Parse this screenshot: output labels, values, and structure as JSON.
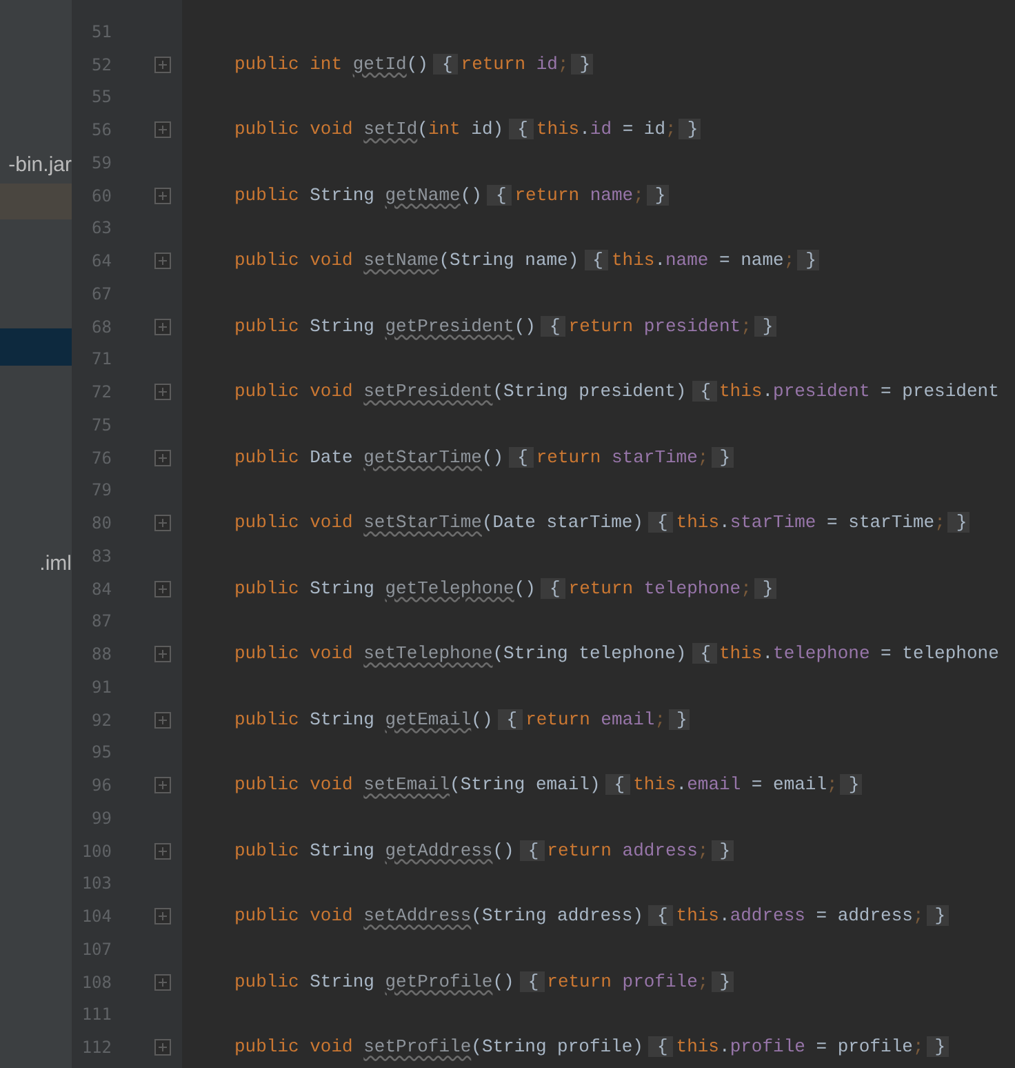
{
  "sidebar": {
    "rows": [
      {
        "label": "-bin.jar",
        "selected": false
      },
      {
        "selected": true,
        "focused": false
      },
      {
        "selected": true,
        "focused": true
      },
      {
        "label": ".iml",
        "selected": false
      }
    ]
  },
  "editor": {
    "lines": [
      {
        "number": "51"
      },
      {
        "number": "52",
        "collapsed": true,
        "tokens": [
          {
            "kind": "kw",
            "text": "public int "
          },
          {
            "kind": "method",
            "text": "getId"
          },
          {
            "kind": "plain",
            "text": "()"
          },
          {
            "kind": "open",
            "text": "{"
          },
          {
            "kind": "kw",
            "text": "return "
          },
          {
            "kind": "field",
            "text": "id"
          },
          {
            "kind": "semi",
            "text": ";"
          },
          {
            "kind": "close",
            "text": "}"
          }
        ]
      },
      {
        "number": "55"
      },
      {
        "number": "56",
        "collapsed": true,
        "tokens": [
          {
            "kind": "kw",
            "text": "public void "
          },
          {
            "kind": "method",
            "text": "setId"
          },
          {
            "kind": "plain",
            "text": "("
          },
          {
            "kind": "kw",
            "text": "int "
          },
          {
            "kind": "plain",
            "text": "id)"
          },
          {
            "kind": "open",
            "text": "{"
          },
          {
            "kind": "kw",
            "text": "this"
          },
          {
            "kind": "plain",
            "text": "."
          },
          {
            "kind": "field",
            "text": "id"
          },
          {
            "kind": "plain",
            "text": " = id"
          },
          {
            "kind": "semi",
            "text": ";"
          },
          {
            "kind": "close",
            "text": "}"
          }
        ]
      },
      {
        "number": "59"
      },
      {
        "number": "60",
        "collapsed": true,
        "tokens": [
          {
            "kind": "kw",
            "text": "public "
          },
          {
            "kind": "plain",
            "text": "String "
          },
          {
            "kind": "method",
            "text": "getName"
          },
          {
            "kind": "plain",
            "text": "()"
          },
          {
            "kind": "open",
            "text": "{"
          },
          {
            "kind": "kw",
            "text": "return "
          },
          {
            "kind": "field",
            "text": "name"
          },
          {
            "kind": "semi",
            "text": ";"
          },
          {
            "kind": "close",
            "text": "}"
          }
        ]
      },
      {
        "number": "63"
      },
      {
        "number": "64",
        "collapsed": true,
        "tokens": [
          {
            "kind": "kw",
            "text": "public void "
          },
          {
            "kind": "method",
            "text": "setName"
          },
          {
            "kind": "plain",
            "text": "(String name)"
          },
          {
            "kind": "open",
            "text": "{"
          },
          {
            "kind": "kw",
            "text": "this"
          },
          {
            "kind": "plain",
            "text": "."
          },
          {
            "kind": "field",
            "text": "name"
          },
          {
            "kind": "plain",
            "text": " = name"
          },
          {
            "kind": "semi",
            "text": ";"
          },
          {
            "kind": "close",
            "text": "}"
          }
        ]
      },
      {
        "number": "67"
      },
      {
        "number": "68",
        "collapsed": true,
        "tokens": [
          {
            "kind": "kw",
            "text": "public "
          },
          {
            "kind": "plain",
            "text": "String "
          },
          {
            "kind": "method",
            "text": "getPresident"
          },
          {
            "kind": "plain",
            "text": "()"
          },
          {
            "kind": "open",
            "text": "{"
          },
          {
            "kind": "kw",
            "text": "return "
          },
          {
            "kind": "field",
            "text": "president"
          },
          {
            "kind": "semi",
            "text": ";"
          },
          {
            "kind": "close",
            "text": "}"
          }
        ]
      },
      {
        "number": "71"
      },
      {
        "number": "72",
        "collapsed": true,
        "tokens": [
          {
            "kind": "kw",
            "text": "public void "
          },
          {
            "kind": "method",
            "text": "setPresident"
          },
          {
            "kind": "plain",
            "text": "(String president)"
          },
          {
            "kind": "open",
            "text": "{"
          },
          {
            "kind": "kw",
            "text": "this"
          },
          {
            "kind": "plain",
            "text": "."
          },
          {
            "kind": "field",
            "text": "president"
          },
          {
            "kind": "plain",
            "text": " = president"
          }
        ]
      },
      {
        "number": "75"
      },
      {
        "number": "76",
        "collapsed": true,
        "tokens": [
          {
            "kind": "kw",
            "text": "public "
          },
          {
            "kind": "plain",
            "text": "Date "
          },
          {
            "kind": "method",
            "text": "getStarTime"
          },
          {
            "kind": "plain",
            "text": "()"
          },
          {
            "kind": "open",
            "text": "{"
          },
          {
            "kind": "kw",
            "text": "return "
          },
          {
            "kind": "field",
            "text": "starTime"
          },
          {
            "kind": "semi",
            "text": ";"
          },
          {
            "kind": "close",
            "text": "}"
          }
        ]
      },
      {
        "number": "79"
      },
      {
        "number": "80",
        "collapsed": true,
        "tokens": [
          {
            "kind": "kw",
            "text": "public void "
          },
          {
            "kind": "method",
            "text": "setStarTime"
          },
          {
            "kind": "plain",
            "text": "(Date starTime)"
          },
          {
            "kind": "open",
            "text": "{"
          },
          {
            "kind": "kw",
            "text": "this"
          },
          {
            "kind": "plain",
            "text": "."
          },
          {
            "kind": "field",
            "text": "starTime"
          },
          {
            "kind": "plain",
            "text": " = starTime"
          },
          {
            "kind": "semi",
            "text": ";"
          },
          {
            "kind": "close",
            "text": "}"
          }
        ]
      },
      {
        "number": "83"
      },
      {
        "number": "84",
        "collapsed": true,
        "tokens": [
          {
            "kind": "kw",
            "text": "public "
          },
          {
            "kind": "plain",
            "text": "String "
          },
          {
            "kind": "method",
            "text": "getTelephone"
          },
          {
            "kind": "plain",
            "text": "()"
          },
          {
            "kind": "open",
            "text": "{"
          },
          {
            "kind": "kw",
            "text": "return "
          },
          {
            "kind": "field",
            "text": "telephone"
          },
          {
            "kind": "semi",
            "text": ";"
          },
          {
            "kind": "close",
            "text": "}"
          }
        ]
      },
      {
        "number": "87"
      },
      {
        "number": "88",
        "collapsed": true,
        "tokens": [
          {
            "kind": "kw",
            "text": "public void "
          },
          {
            "kind": "method",
            "text": "setTelephone"
          },
          {
            "kind": "plain",
            "text": "(String telephone)"
          },
          {
            "kind": "open",
            "text": "{"
          },
          {
            "kind": "kw",
            "text": "this"
          },
          {
            "kind": "plain",
            "text": "."
          },
          {
            "kind": "field",
            "text": "telephone"
          },
          {
            "kind": "plain",
            "text": " = telephone"
          }
        ]
      },
      {
        "number": "91"
      },
      {
        "number": "92",
        "collapsed": true,
        "tokens": [
          {
            "kind": "kw",
            "text": "public "
          },
          {
            "kind": "plain",
            "text": "String "
          },
          {
            "kind": "method",
            "text": "getEmail"
          },
          {
            "kind": "plain",
            "text": "()"
          },
          {
            "kind": "open",
            "text": "{"
          },
          {
            "kind": "kw",
            "text": "return "
          },
          {
            "kind": "field",
            "text": "email"
          },
          {
            "kind": "semi",
            "text": ";"
          },
          {
            "kind": "close",
            "text": "}"
          }
        ]
      },
      {
        "number": "95"
      },
      {
        "number": "96",
        "collapsed": true,
        "tokens": [
          {
            "kind": "kw",
            "text": "public void "
          },
          {
            "kind": "method",
            "text": "setEmail"
          },
          {
            "kind": "plain",
            "text": "(String email)"
          },
          {
            "kind": "open",
            "text": "{"
          },
          {
            "kind": "kw",
            "text": "this"
          },
          {
            "kind": "plain",
            "text": "."
          },
          {
            "kind": "field",
            "text": "email"
          },
          {
            "kind": "plain",
            "text": " = email"
          },
          {
            "kind": "semi",
            "text": ";"
          },
          {
            "kind": "close",
            "text": "}"
          }
        ]
      },
      {
        "number": "99"
      },
      {
        "number": "100",
        "collapsed": true,
        "tokens": [
          {
            "kind": "kw",
            "text": "public "
          },
          {
            "kind": "plain",
            "text": "String "
          },
          {
            "kind": "method",
            "text": "getAddress"
          },
          {
            "kind": "plain",
            "text": "()"
          },
          {
            "kind": "open",
            "text": "{"
          },
          {
            "kind": "kw",
            "text": "return "
          },
          {
            "kind": "field",
            "text": "address"
          },
          {
            "kind": "semi",
            "text": ";"
          },
          {
            "kind": "close",
            "text": "}"
          }
        ]
      },
      {
        "number": "103"
      },
      {
        "number": "104",
        "collapsed": true,
        "tokens": [
          {
            "kind": "kw",
            "text": "public void "
          },
          {
            "kind": "method",
            "text": "setAddress"
          },
          {
            "kind": "plain",
            "text": "(String address)"
          },
          {
            "kind": "open",
            "text": "{"
          },
          {
            "kind": "kw",
            "text": "this"
          },
          {
            "kind": "plain",
            "text": "."
          },
          {
            "kind": "field",
            "text": "address"
          },
          {
            "kind": "plain",
            "text": " = address"
          },
          {
            "kind": "semi",
            "text": ";"
          },
          {
            "kind": "close",
            "text": "}"
          }
        ]
      },
      {
        "number": "107"
      },
      {
        "number": "108",
        "collapsed": true,
        "tokens": [
          {
            "kind": "kw",
            "text": "public "
          },
          {
            "kind": "plain",
            "text": "String "
          },
          {
            "kind": "method",
            "text": "getProfile"
          },
          {
            "kind": "plain",
            "text": "()"
          },
          {
            "kind": "open",
            "text": "{"
          },
          {
            "kind": "kw",
            "text": "return "
          },
          {
            "kind": "field",
            "text": "profile"
          },
          {
            "kind": "semi",
            "text": ";"
          },
          {
            "kind": "close",
            "text": "}"
          }
        ]
      },
      {
        "number": "111"
      },
      {
        "number": "112",
        "collapsed": true,
        "tokens": [
          {
            "kind": "kw",
            "text": "public void "
          },
          {
            "kind": "method",
            "text": "setProfile"
          },
          {
            "kind": "plain",
            "text": "(String profile)"
          },
          {
            "kind": "open",
            "text": "{"
          },
          {
            "kind": "kw",
            "text": "this"
          },
          {
            "kind": "plain",
            "text": "."
          },
          {
            "kind": "field",
            "text": "profile"
          },
          {
            "kind": "plain",
            "text": " = profile"
          },
          {
            "kind": "semi",
            "text": ";"
          },
          {
            "kind": "close",
            "text": "}"
          }
        ]
      }
    ]
  }
}
